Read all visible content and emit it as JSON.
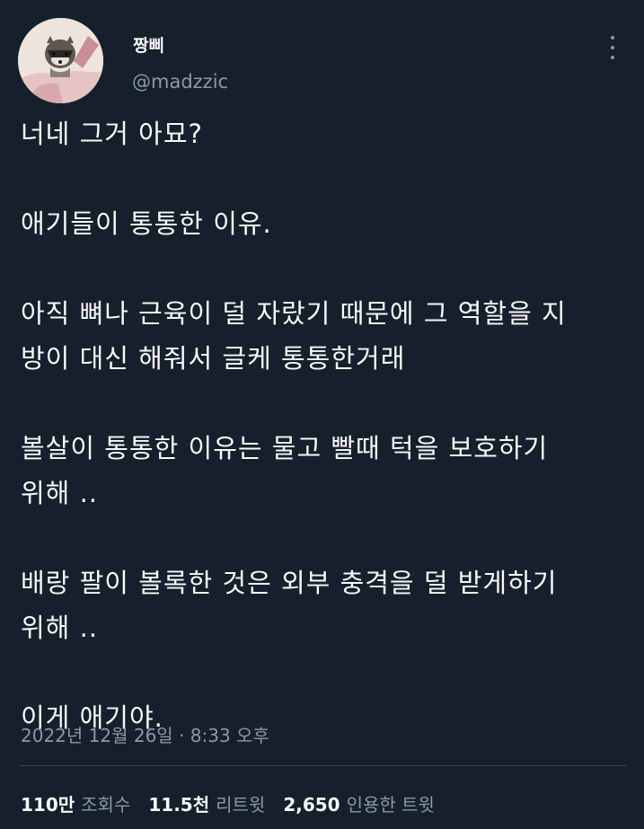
{
  "user": {
    "display_name": "짱삐",
    "handle": "@madzzic",
    "avatar_icon": "raccoon-avatar"
  },
  "tweet": {
    "lines": [
      "너네 그거 아묘?",
      "",
      "애기들이 통통한 이유.",
      "",
      "아직 뼈나 근육이 덜 자랐기 때문에 그 역할을 지",
      "방이 대신 해줘서 글케 통통한거래",
      "",
      "볼살이 통통한 이유는 물고 빨때 턱을 보호하기",
      "위해 ..",
      "",
      "배랑 팔이 볼록한 것은 외부 충격을 덜 받게하기",
      "위해 ..",
      "",
      "이게 애기야."
    ],
    "timestamp": "2022년 12월 26일 · 8:33 오후"
  },
  "stats": {
    "views_count": "110만",
    "views_label": "조회수",
    "retweets_count": "11.5천",
    "retweets_label": "리트윗",
    "quotes_count": "2,650",
    "quotes_label": "인용한 트윗"
  },
  "colors": {
    "background": "#15202b",
    "text_primary": "#f7f9f9",
    "text_secondary": "#8b98a5"
  }
}
